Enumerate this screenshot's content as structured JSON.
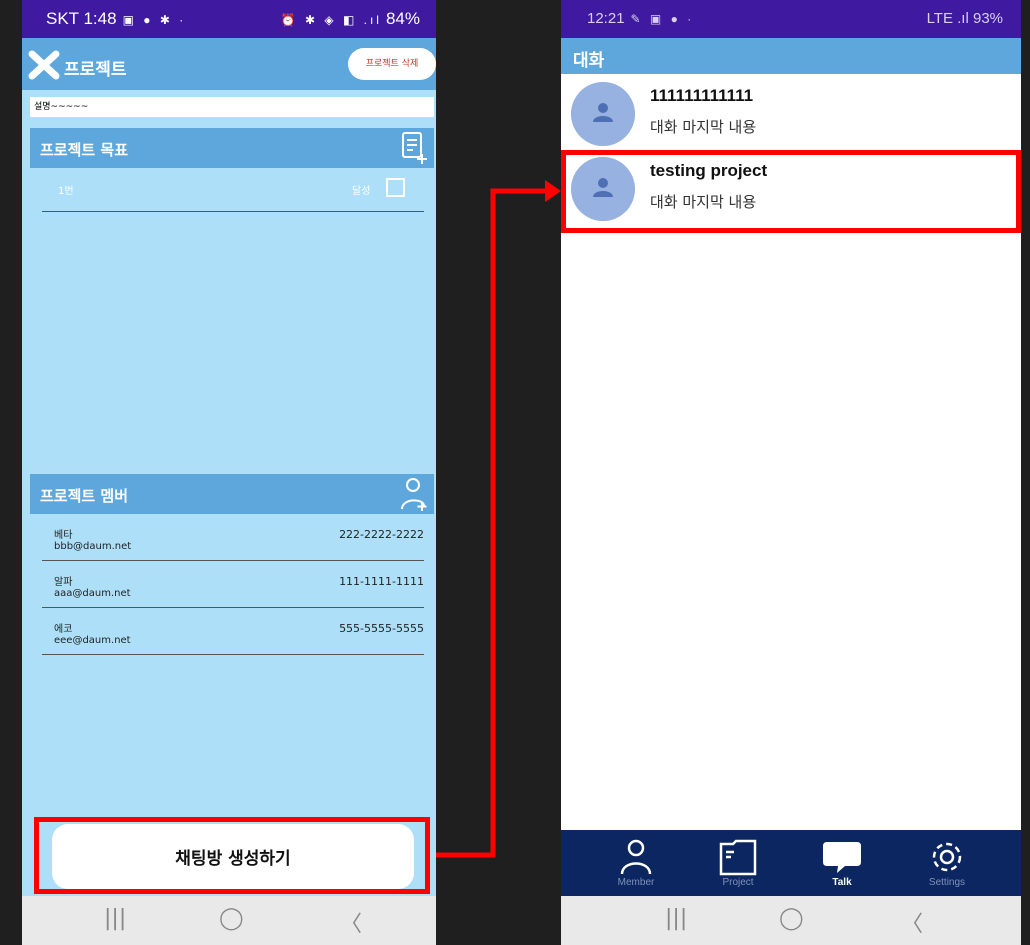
{
  "left": {
    "status": {
      "carrier_time": "SKT 1:48",
      "icons_left": "▣ ● ✱ ·",
      "icons_right": "⏰ ✱ ◈ ◧ .ıl",
      "battery": "84%"
    },
    "appbar": {
      "title": "프로젝트",
      "delete_label": "프로젝트 삭제"
    },
    "description": "설명~~~~~",
    "goals": {
      "header": "프로젝트 목표",
      "items": [
        {
          "name": "1번",
          "status": "달성"
        }
      ]
    },
    "members": {
      "header": "프로젝트 멤버",
      "items": [
        {
          "name": "베타",
          "email": "bbb@daum.net",
          "phone": "222-2222-2222"
        },
        {
          "name": "알파",
          "email": "aaa@daum.net",
          "phone": "111-1111-1111"
        },
        {
          "name": "에코",
          "email": "eee@daum.net",
          "phone": "555-5555-5555"
        }
      ]
    },
    "create_chat_label": "채팅방 생성하기",
    "nav": {
      "recents": "|||",
      "home": "◯",
      "back": "〈"
    }
  },
  "right": {
    "status": {
      "time": "12:21",
      "icons_left": "✎ ▣ ● ·",
      "signal": "LTE .ıl 93%"
    },
    "appbar": {
      "title": "대화"
    },
    "chats": [
      {
        "name": "111111111111",
        "last_message": "대화 마지막 내용"
      },
      {
        "name": "testing project",
        "last_message": "대화 마지막 내용"
      }
    ],
    "tabs": [
      {
        "label": "Member",
        "icon": "person-icon"
      },
      {
        "label": "Project",
        "icon": "folder-icon"
      },
      {
        "label": "Talk",
        "icon": "chat-bubble-icon",
        "active": true
      },
      {
        "label": "Settings",
        "icon": "gear-icon"
      }
    ],
    "nav": {
      "recents": "|||",
      "home": "◯",
      "back": "〈"
    }
  },
  "colors": {
    "status_bar": "#3f1aa0",
    "app_bar": "#5ea7dc",
    "left_background": "#ade0f8",
    "bottom_tab_bar": "#0b2660",
    "highlight": "#ff0000",
    "avatar": "#97b2e0"
  }
}
